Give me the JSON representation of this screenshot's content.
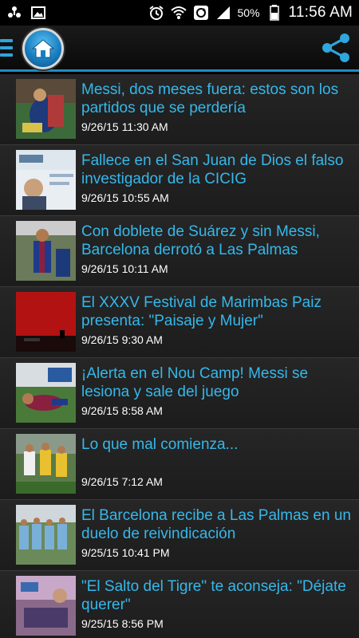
{
  "status_bar": {
    "battery_percent": "50%",
    "time": "11:56 AM",
    "icons": [
      "usb-icon",
      "image-icon",
      "alarm-icon",
      "wifi-icon",
      "sync-icon",
      "signal-icon",
      "battery-icon"
    ]
  },
  "app_bar": {
    "icons": [
      "menu-icon",
      "home-icon",
      "share-icon"
    ],
    "accent_color": "#1c8fc1"
  },
  "articles": [
    {
      "title": "Messi, dos meses fuera: estos son los partidos que se perdería",
      "date": "9/26/15 11:30 AM"
    },
    {
      "title": "Fallece en el San Juan de Dios el falso investigador de la CICIG",
      "date": "9/26/15 10:55 AM"
    },
    {
      "title": "Con doblete de Suárez y sin Messi, Barcelona derrotó a Las Palmas",
      "date": "9/26/15 10:11 AM"
    },
    {
      "title": "El XXXV Festival de Marimbas Paiz presenta: \"Paisaje y Mujer\"",
      "date": "9/26/15 9:30 AM"
    },
    {
      "title": "¡Alerta en el Nou Camp! Messi se lesiona y sale del juego",
      "date": "9/26/15 8:58 AM"
    },
    {
      "title": "Lo que mal comienza...",
      "date": "9/26/15 7:12 AM"
    },
    {
      "title": "El Barcelona recibe a Las Palmas en un duelo de reivindicación",
      "date": "9/25/15 10:41 PM"
    },
    {
      "title": "\"El Salto del Tigre\" te aconseja: \"Déjate querer\"",
      "date": "9/25/15 8:56 PM"
    }
  ],
  "colors": {
    "title_text": "#35b8ea",
    "date_text": "#ffffff",
    "list_background": "#202020"
  }
}
